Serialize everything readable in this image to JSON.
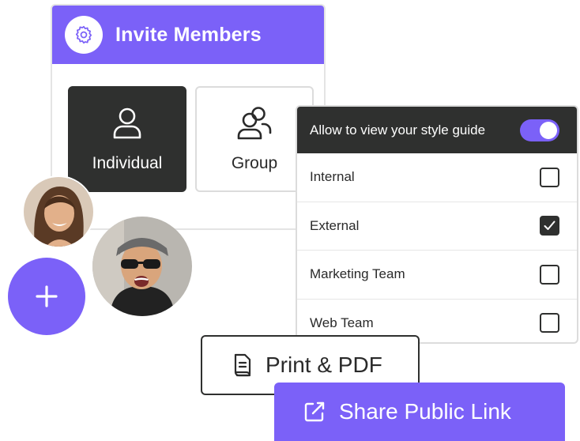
{
  "invite": {
    "title": "Invite Members",
    "options": [
      {
        "label": "Individual",
        "selected": true
      },
      {
        "label": "Group",
        "selected": false
      }
    ]
  },
  "permissions": {
    "header_label": "Allow to view your style guide",
    "toggle_on": true,
    "items": [
      {
        "label": "Internal",
        "checked": false
      },
      {
        "label": "External",
        "checked": true
      },
      {
        "label": "Marketing Team",
        "checked": false
      },
      {
        "label": "Web Team",
        "checked": false
      }
    ]
  },
  "actions": {
    "print_label": "Print & PDF",
    "share_label": "Share Public Link"
  },
  "icons": {
    "header": "gear-icon",
    "individual": "user-icon",
    "group": "users-icon",
    "add": "plus-icon",
    "print": "document-icon",
    "share": "external-link-icon"
  },
  "colors": {
    "accent": "#7b61f8",
    "dark": "#2f302f"
  }
}
